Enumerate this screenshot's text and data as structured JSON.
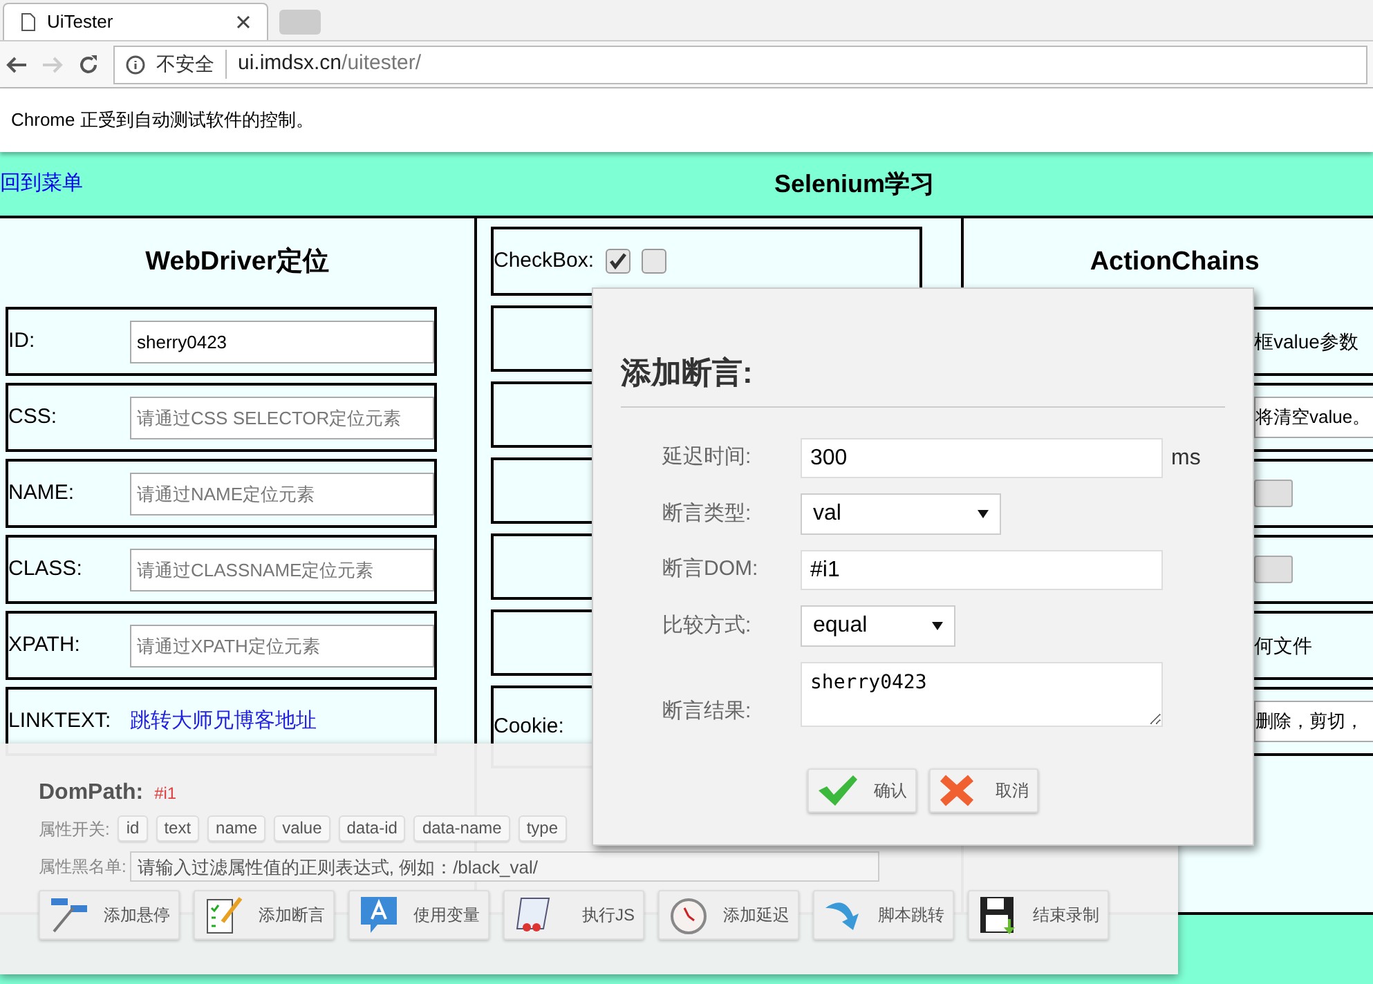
{
  "browser": {
    "tab_title": "UiTester",
    "address": {
      "security": "不安全",
      "host": "ui.imdsx.cn",
      "path": "/uitester/"
    },
    "infobar": "Chrome 正受到自动测试软件的控制。"
  },
  "header": {
    "back_link": "回到菜单",
    "title": "Selenium学习"
  },
  "webdriver": {
    "title": "WebDriver定位",
    "rows": [
      {
        "kind": "input",
        "label": "ID:",
        "value": "sherry0423"
      },
      {
        "kind": "input",
        "label": "CSS:",
        "placeholder": "请通过CSS SELECTOR定位元素"
      },
      {
        "kind": "input",
        "label": "NAME:",
        "placeholder": "请通过NAME定位元素"
      },
      {
        "kind": "input",
        "label": "CLASS:",
        "placeholder": "请通过CLASSNAME定位元素"
      },
      {
        "kind": "input",
        "label": "XPATH:",
        "placeholder": "请通过XPATH定位元素"
      },
      {
        "kind": "link",
        "label": "LINKTEXT:",
        "link": "跳转大师兄博客地址"
      }
    ]
  },
  "middle": {
    "checkbox_label": "CheckBox:",
    "checkboxes": [
      {
        "checked": true
      },
      {
        "checked": false
      }
    ],
    "cookie_label": "Cookie:"
  },
  "action_chains": {
    "title": "ActionChains",
    "rows": [
      {
        "kind": "text",
        "text": "框value参数"
      },
      {
        "kind": "field",
        "text": "将清空value。"
      },
      {
        "kind": "button"
      },
      {
        "kind": "button"
      },
      {
        "kind": "text",
        "text": "何文件"
      },
      {
        "kind": "field",
        "text": "删除，剪切，"
      }
    ]
  },
  "dialog": {
    "title": "添加断言:",
    "fields": [
      {
        "kind": "input",
        "label": "延迟时间:",
        "value": "300",
        "unit": "ms"
      },
      {
        "kind": "select",
        "label": "断言类型:",
        "value": "val"
      },
      {
        "kind": "input",
        "label": "断言DOM:",
        "value": "#i1"
      },
      {
        "kind": "select",
        "label": "比较方式:",
        "value": "equal"
      },
      {
        "kind": "textarea",
        "label": "断言结果:",
        "value": "sherry0423"
      }
    ],
    "buttons": [
      "确认",
      "取消"
    ]
  },
  "recorder": {
    "dompath_label": "DomPath:",
    "dompath_value": "#i1",
    "attr_label": "属性开关:",
    "attrs": [
      "id",
      "text",
      "name",
      "value",
      "data-id",
      "data-name",
      "type"
    ],
    "blacklist_label": "属性黑名单:",
    "blacklist_placeholder": "请输入过滤属性值的正则表达式, 例如：/black_val/",
    "tools": [
      "添加悬停",
      "添加断言",
      "使用变量",
      "执行JS",
      "添加延迟",
      "脚本跳转",
      "结束录制"
    ]
  }
}
